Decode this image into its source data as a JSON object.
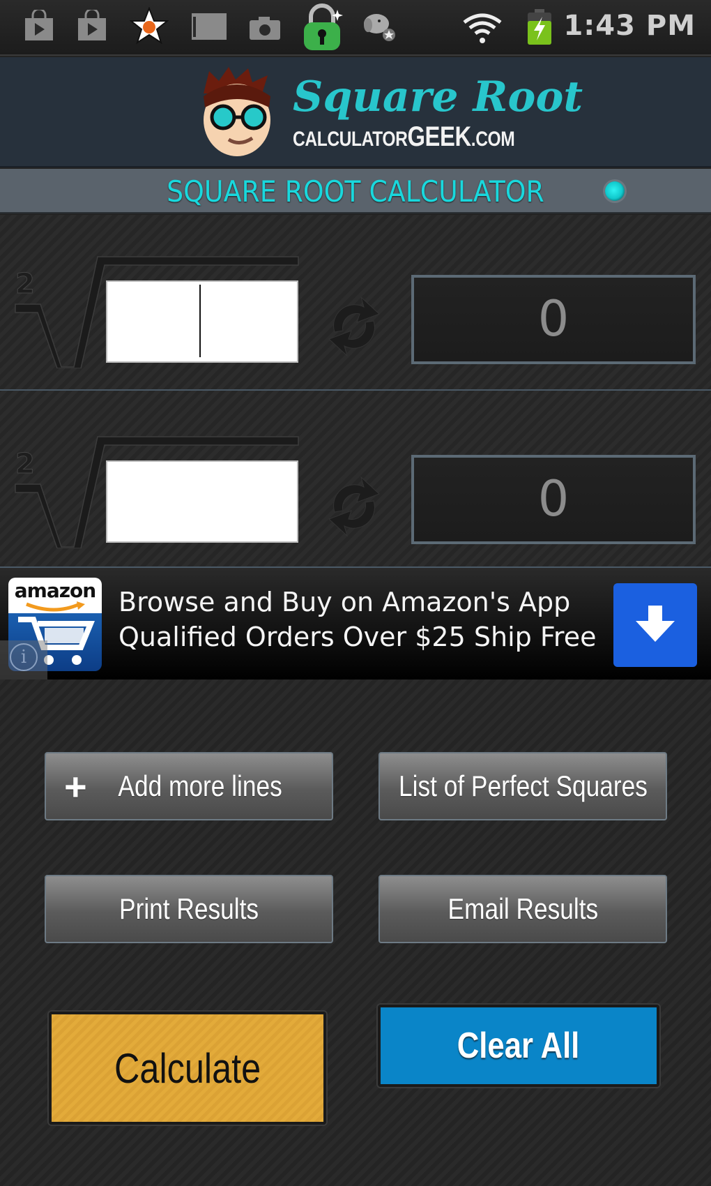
{
  "status_bar": {
    "notification_icons": [
      "play-store-icon",
      "play-store-icon",
      "favorite-star-icon",
      "gmail-icon",
      "camera-icon",
      "security-lock-icon",
      "dog-app-icon"
    ],
    "system_icons": [
      "wifi-icon",
      "battery-charging-icon"
    ],
    "time": "1:43 PM"
  },
  "header": {
    "logo_title": "Square Root",
    "logo_sub_prefix": "CALCULATOR",
    "logo_sub_brand": "GEEK",
    "logo_sub_suffix": ".COM"
  },
  "title_strip": {
    "title": "SQUARE ROOT CALCULATOR",
    "indicator_color": "#19d8dd"
  },
  "calc_rows": [
    {
      "index": "2",
      "input_value": "",
      "result": "0",
      "focused": true
    },
    {
      "index": "2",
      "input_value": "",
      "result": "0",
      "focused": false
    }
  ],
  "ad": {
    "brand": "amazon",
    "line1": "Browse and Buy on Amazon's App",
    "line2": "Qualified Orders Over $25 Ship Free",
    "info_glyph": "i"
  },
  "buttons": {
    "add_lines_icon": "+",
    "add_lines": "Add more lines",
    "perfect_squares": "List of Perfect Squares",
    "print": "Print Results",
    "email": "Email Results",
    "calculate": "Calculate",
    "clear_all": "Clear All"
  },
  "colors": {
    "accent_cyan": "#19d8dd",
    "calculate_yellow": "#e3ab3a",
    "clear_blue": "#0a85c8",
    "ad_cta_blue": "#1b60e0"
  }
}
